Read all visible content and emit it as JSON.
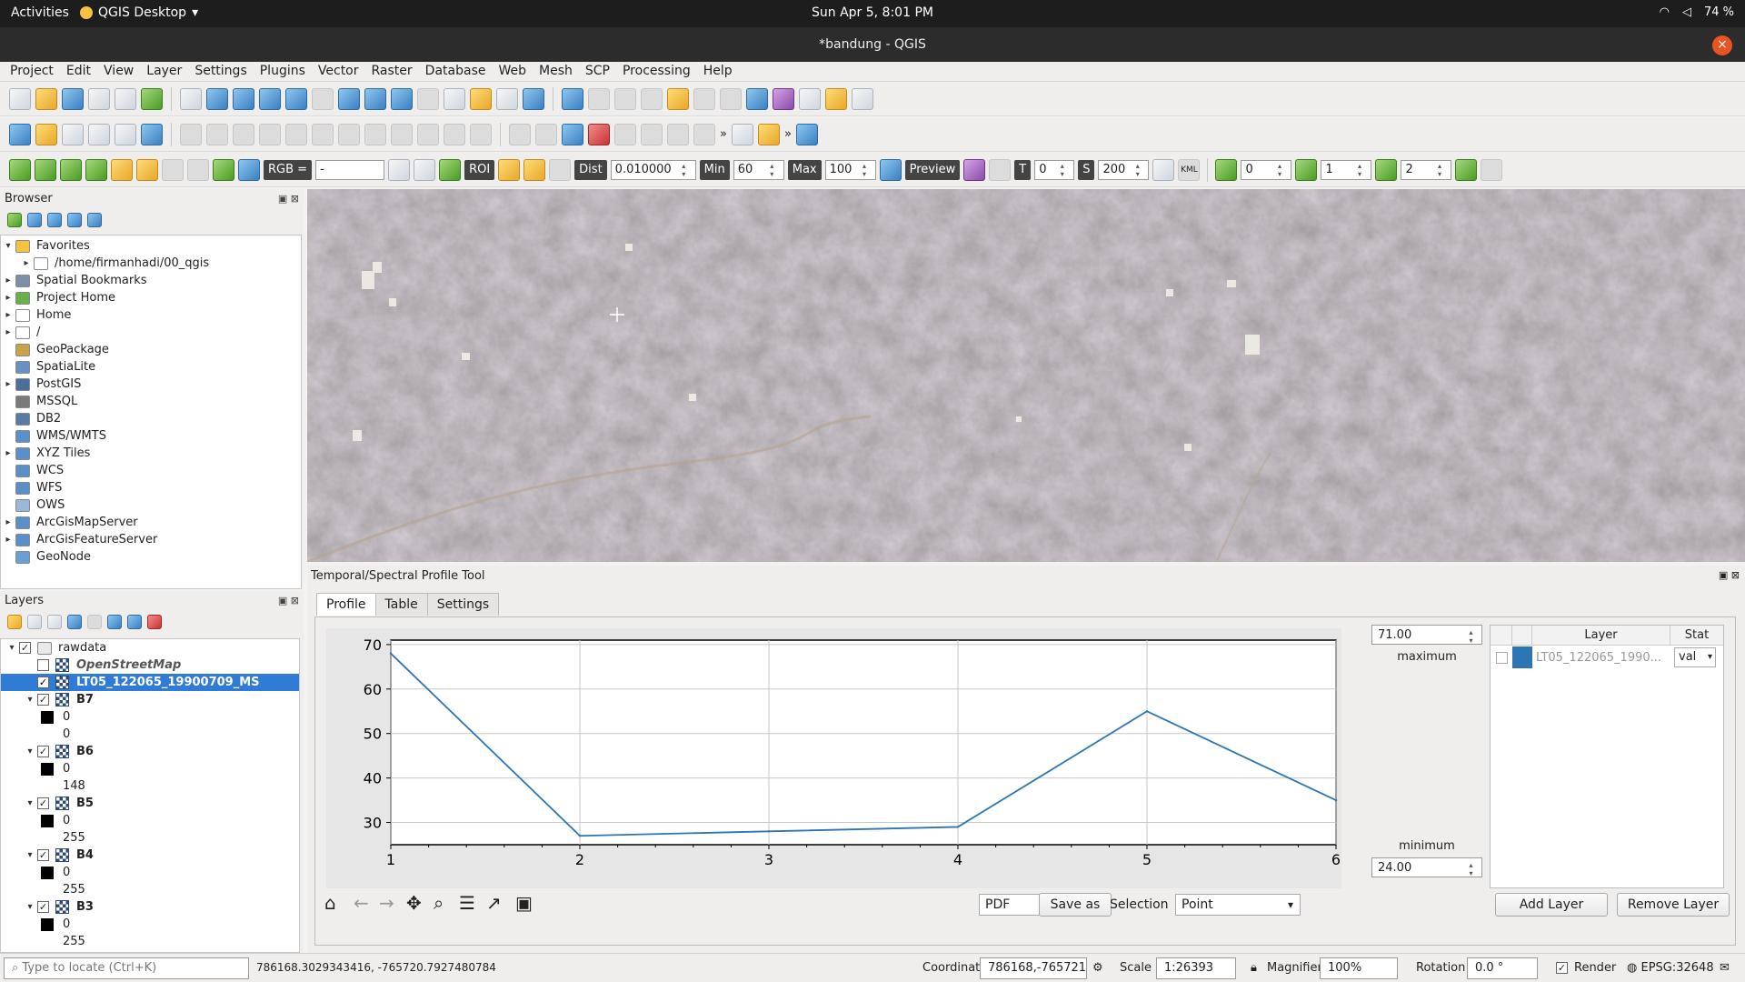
{
  "topbar": {
    "activities": "Activities",
    "app": "QGIS Desktop",
    "clock": "Sun Apr 5, 8:01 PM",
    "battery": "74 %"
  },
  "window": {
    "title": "*bandung - QGIS"
  },
  "menu": [
    "Project",
    "Edit",
    "View",
    "Layer",
    "Settings",
    "Plugins",
    "Vector",
    "Raster",
    "Database",
    "Web",
    "Mesh",
    "SCP",
    "Processing",
    "Help"
  ],
  "scp_toolbar": {
    "rgb_label": "RGB =",
    "rgb_value": "-",
    "roi": "ROI",
    "dist_label": "Dist",
    "dist_value": "0.010000",
    "min_label": "Min",
    "min_value": "60",
    "max_label": "Max",
    "max_value": "100",
    "preview": "Preview",
    "t_label": "T",
    "t_value": "0",
    "s_label": "S",
    "s_value": "200",
    "kml": "KML",
    "band0": "0",
    "band1": "1",
    "band2": "2"
  },
  "browser": {
    "title": "Browser",
    "items": [
      {
        "label": "Favorites",
        "expand": "▾",
        "indent": 0,
        "icon": "star-icon",
        "color": "#f5c242"
      },
      {
        "label": "/home/firmanhadi/00_qgis",
        "expand": "▸",
        "indent": 1,
        "icon": "folder-icon",
        "color": "#ffffff"
      },
      {
        "label": "Spatial Bookmarks",
        "expand": "▸",
        "indent": 0,
        "icon": "bookmark-icon",
        "color": "#7d8fa6"
      },
      {
        "label": "Project Home",
        "expand": "▸",
        "indent": 0,
        "icon": "project-home-icon",
        "color": "#6ab04c"
      },
      {
        "label": "Home",
        "expand": "▸",
        "indent": 0,
        "icon": "home-icon",
        "color": "#ffffff"
      },
      {
        "label": "/",
        "expand": "▸",
        "indent": 0,
        "icon": "folder-icon",
        "color": "#ffffff"
      },
      {
        "label": "GeoPackage",
        "expand": "",
        "indent": 0,
        "icon": "geopackage-icon",
        "color": "#c9a24a"
      },
      {
        "label": "SpatiaLite",
        "expand": "",
        "indent": 0,
        "icon": "spatialite-icon",
        "color": "#6a8fc2"
      },
      {
        "label": "PostGIS",
        "expand": "▸",
        "indent": 0,
        "icon": "postgis-icon",
        "color": "#4a6f9c"
      },
      {
        "label": "MSSQL",
        "expand": "",
        "indent": 0,
        "icon": "mssql-icon",
        "color": "#7a7a7a"
      },
      {
        "label": "DB2",
        "expand": "",
        "indent": 0,
        "icon": "db2-icon",
        "color": "#5a7aa6"
      },
      {
        "label": "WMS/WMTS",
        "expand": "",
        "indent": 0,
        "icon": "wms-icon",
        "color": "#5a8fc9"
      },
      {
        "label": "XYZ Tiles",
        "expand": "▸",
        "indent": 0,
        "icon": "xyz-icon",
        "color": "#5a8fc9"
      },
      {
        "label": "WCS",
        "expand": "",
        "indent": 0,
        "icon": "wcs-icon",
        "color": "#5a8fc9"
      },
      {
        "label": "WFS",
        "expand": "",
        "indent": 0,
        "icon": "wfs-icon",
        "color": "#5a8fc9"
      },
      {
        "label": "OWS",
        "expand": "",
        "indent": 0,
        "icon": "ows-icon",
        "color": "#9db7d6"
      },
      {
        "label": "ArcGisMapServer",
        "expand": "▸",
        "indent": 0,
        "icon": "arcgis-icon",
        "color": "#5a8fc9"
      },
      {
        "label": "ArcGisFeatureServer",
        "expand": "▸",
        "indent": 0,
        "icon": "arcgis-icon",
        "color": "#5a8fc9"
      },
      {
        "label": "GeoNode",
        "expand": "",
        "indent": 0,
        "icon": "geonode-icon",
        "color": "#6a9fd6"
      }
    ]
  },
  "layers": {
    "title": "Layers",
    "rows": [
      {
        "kind": "group",
        "label": "rawdata",
        "expand": "▾",
        "checked": "✓",
        "bold": false,
        "italic": false,
        "selected": false,
        "indent": 0
      },
      {
        "kind": "layer",
        "label": "OpenStreetMap",
        "expand": "",
        "checked": "",
        "bold": true,
        "italic": true,
        "selected": false,
        "indent": 1
      },
      {
        "kind": "layer",
        "label": "LT05_122065_19900709_MS",
        "expand": "",
        "checked": "✓",
        "bold": true,
        "italic": false,
        "selected": true,
        "indent": 1
      },
      {
        "kind": "layer",
        "label": "B7",
        "expand": "▾",
        "checked": "✓",
        "bold": true,
        "italic": false,
        "selected": false,
        "indent": 1
      },
      {
        "kind": "value",
        "label": "0",
        "swatch": true,
        "indent": 2
      },
      {
        "kind": "value",
        "label": "0",
        "swatch": false,
        "indent": 2
      },
      {
        "kind": "layer",
        "label": "B6",
        "expand": "▾",
        "checked": "✓",
        "bold": true,
        "italic": false,
        "selected": false,
        "indent": 1
      },
      {
        "kind": "value",
        "label": "0",
        "swatch": true,
        "indent": 2
      },
      {
        "kind": "value",
        "label": "148",
        "swatch": false,
        "indent": 2
      },
      {
        "kind": "layer",
        "label": "B5",
        "expand": "▾",
        "checked": "✓",
        "bold": true,
        "italic": false,
        "selected": false,
        "indent": 1
      },
      {
        "kind": "value",
        "label": "0",
        "swatch": true,
        "indent": 2
      },
      {
        "kind": "value",
        "label": "255",
        "swatch": false,
        "indent": 2
      },
      {
        "kind": "layer",
        "label": "B4",
        "expand": "▾",
        "checked": "✓",
        "bold": true,
        "italic": false,
        "selected": false,
        "indent": 1
      },
      {
        "kind": "value",
        "label": "0",
        "swatch": true,
        "indent": 2
      },
      {
        "kind": "value",
        "label": "255",
        "swatch": false,
        "indent": 2
      },
      {
        "kind": "layer",
        "label": "B3",
        "expand": "▾",
        "checked": "✓",
        "bold": true,
        "italic": false,
        "selected": false,
        "indent": 1
      },
      {
        "kind": "value",
        "label": "0",
        "swatch": true,
        "indent": 2
      },
      {
        "kind": "value",
        "label": "255",
        "swatch": false,
        "indent": 2
      }
    ]
  },
  "profile": {
    "title": "Temporal/Spectral Profile Tool",
    "tabs": [
      "Profile",
      "Table",
      "Settings"
    ],
    "max_value": "71.00",
    "max_label": "maximum",
    "min_label": "minimum",
    "min_value": "24.00",
    "layer_header": "Layer",
    "stat_header": "Stat",
    "layer_row": {
      "name": "LT05_122065_1990...",
      "stat": "val",
      "color": "#2e75b6"
    },
    "format": "PDF",
    "save_as": "Save as",
    "selection_label": "Selection",
    "selection_value": "Point",
    "add_layer": "Add Layer",
    "remove_layer": "Remove Layer"
  },
  "chart_data": {
    "type": "line",
    "x": [
      1,
      2,
      3,
      4,
      5,
      6
    ],
    "series": [
      {
        "values": [
          68,
          27,
          28,
          29,
          55,
          35
        ],
        "color": "#2e75b6"
      }
    ],
    "xlim": [
      1,
      6
    ],
    "ylim": [
      25,
      71
    ],
    "xticks": [
      "1",
      "2",
      "3",
      "4",
      "5",
      "6"
    ],
    "yticks": [
      "30",
      "40",
      "50",
      "60",
      "70"
    ],
    "grid": true
  },
  "status": {
    "locate_placeholder": "Type to locate (Ctrl+K)",
    "cursor_coords": "786168.3029343416, -765720.7927480784",
    "coordinate_label": "Coordinate",
    "coordinate_value": "786168,-765721",
    "scale_label": "Scale",
    "scale_value": "1:26393",
    "magnifier_label": "Magnifier",
    "magnifier_value": "100%",
    "rotation_label": "Rotation",
    "rotation_value": "0.0 °",
    "render_label": "Render",
    "crs": "EPSG:32648"
  }
}
